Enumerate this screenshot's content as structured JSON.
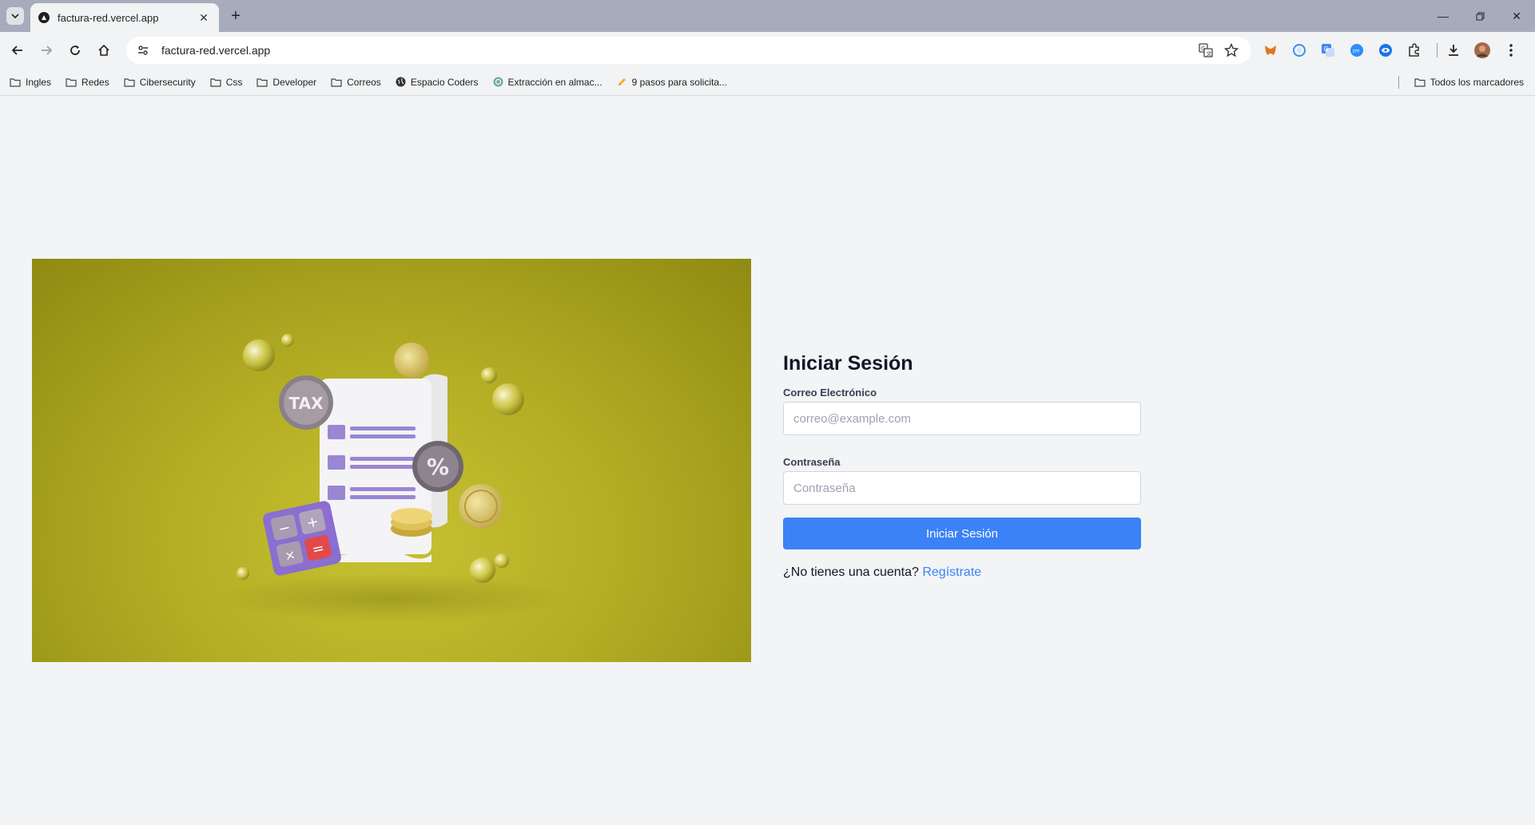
{
  "browser": {
    "tab_title": "factura-red.vercel.app",
    "url": "factura-red.vercel.app",
    "bookmarks": [
      {
        "label": "Ingles",
        "icon": "folder-icon"
      },
      {
        "label": "Redes",
        "icon": "folder-icon"
      },
      {
        "label": "Cibersecurity",
        "icon": "folder-icon"
      },
      {
        "label": "Css",
        "icon": "folder-icon"
      },
      {
        "label": "Developer",
        "icon": "folder-icon"
      },
      {
        "label": "Correos",
        "icon": "folder-icon"
      },
      {
        "label": "Espacio Coders",
        "icon": "globe-icon"
      },
      {
        "label": "Extracción en almac...",
        "icon": "chatgpt-icon"
      },
      {
        "label": "9 pasos para solicita...",
        "icon": "pencil-icon"
      }
    ],
    "all_bookmarks_label": "Todos los marcadores"
  },
  "hero": {
    "tax_label": "TAX",
    "percent_symbol": "%"
  },
  "login": {
    "title": "Iniciar Sesión",
    "email_label": "Correo Electrónico",
    "email_placeholder": "correo@example.com",
    "email_value": "",
    "password_label": "Contraseña",
    "password_placeholder": "Contraseña",
    "password_value": "",
    "submit_label": "Iniciar Sesión",
    "signup_prompt": "¿No tienes una cuenta?",
    "signup_link": "Regístrate"
  },
  "colors": {
    "primary": "#3b82f6",
    "page_bg": "#f3f4f6",
    "hero_bg": "#b3ad24"
  }
}
